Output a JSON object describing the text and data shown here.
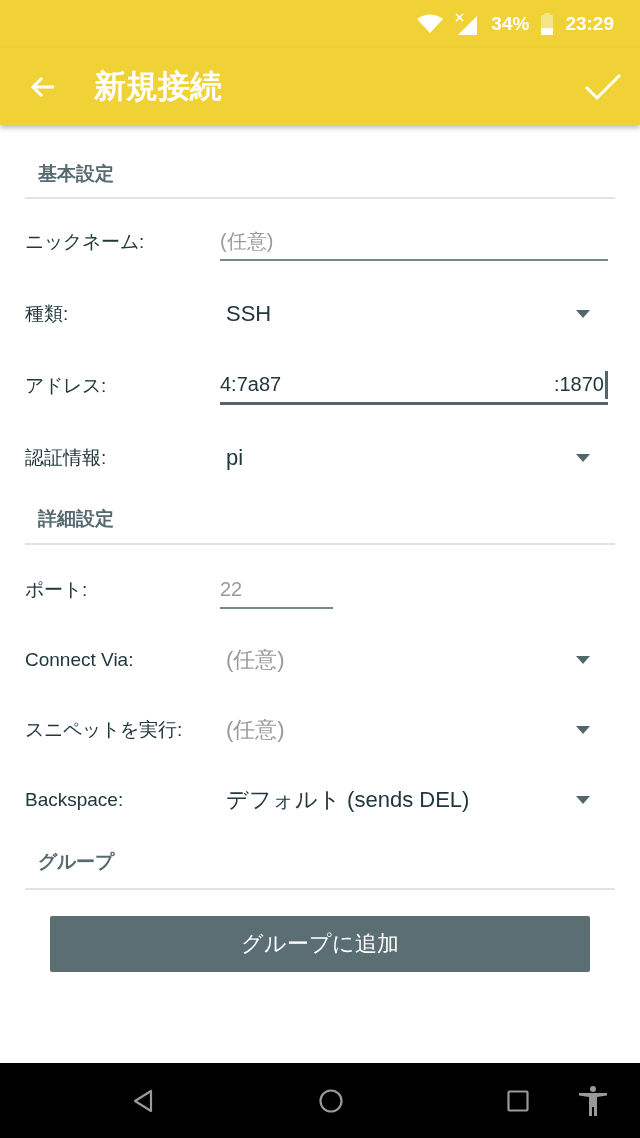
{
  "status_bar": {
    "battery": "34%",
    "time": "23:29"
  },
  "app_bar": {
    "title": "新規接続"
  },
  "sections": [
    {
      "title": "基本設定",
      "rows": [
        {
          "kind": "text",
          "label": "ニックネーム:",
          "placeholder": "(任意)"
        },
        {
          "kind": "dropdown",
          "label": "種類:",
          "value": "SSH"
        },
        {
          "kind": "split",
          "label": "アドレス:",
          "value_start": "4:7a87",
          "value_end": ":1870",
          "focused": true
        },
        {
          "kind": "dropdown",
          "label": "認証情報:",
          "value": "pi"
        }
      ]
    },
    {
      "title": "詳細設定",
      "rows": [
        {
          "kind": "short",
          "label": "ポート:",
          "placeholder": "22"
        },
        {
          "kind": "dropdown",
          "label": "Connect Via:",
          "placeholder": "(任意)"
        },
        {
          "kind": "dropdown",
          "label": "スニペットを実行:",
          "placeholder": "(任意)"
        },
        {
          "kind": "dropdown",
          "label": "Backspace:",
          "value": "デフォルト (sends DEL)"
        }
      ]
    },
    {
      "title": "グループ",
      "button": "グループに追加"
    }
  ]
}
